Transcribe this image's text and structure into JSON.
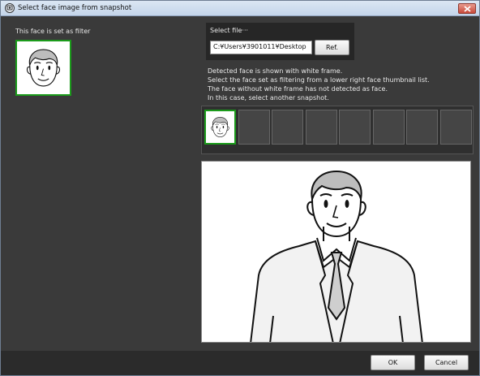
{
  "window": {
    "title": "Select face image from snapshot"
  },
  "left_panel": {
    "filter_label": "This face is set as filter"
  },
  "file_panel": {
    "label": "Select file···",
    "path_value": "C:¥Users¥3901011¥Desktop",
    "ref_button": "Ref."
  },
  "instructions": [
    "Detected face is shown with white frame.",
    "Select the face set as filtering from a lower right face thumbnail list.",
    "The face without white frame has not detected as face.",
    "In this case, select another snapshot."
  ],
  "thumbnails": {
    "total_slots": 8,
    "selected_index": 0
  },
  "footer": {
    "ok_button": "OK",
    "cancel_button": "Cancel"
  },
  "colors": {
    "background": "#3a3a3a",
    "selection_frame": "#1b9b1b",
    "panel_dark": "#262626",
    "titlebar": "#c4d5ea"
  }
}
